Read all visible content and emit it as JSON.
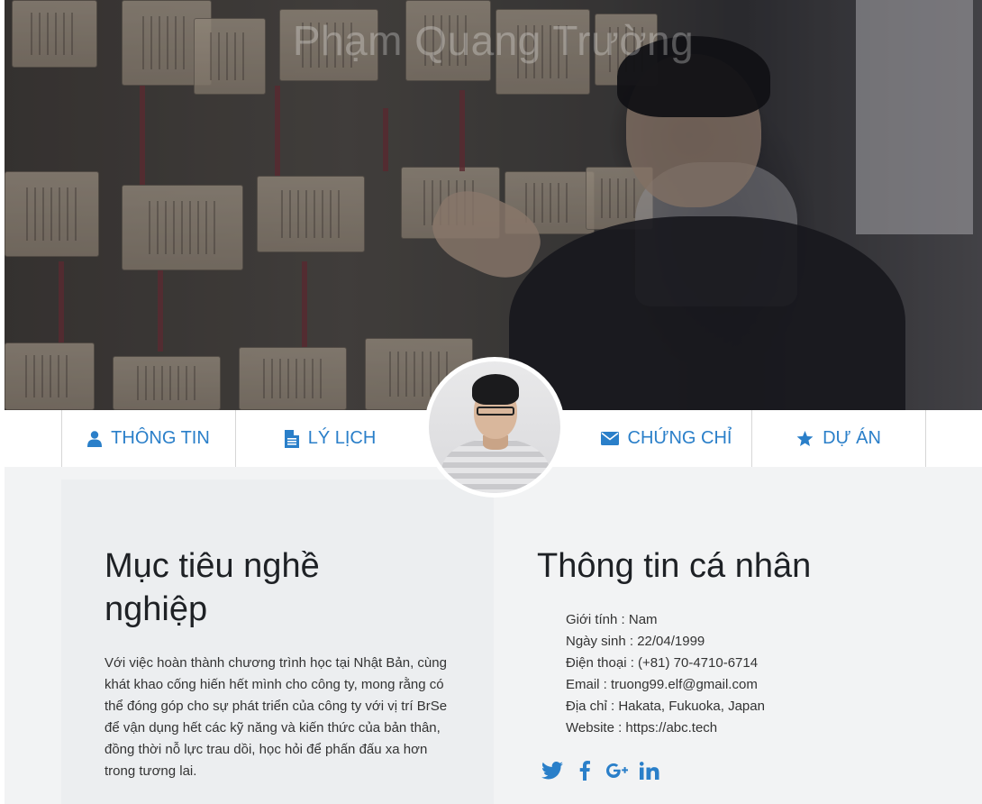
{
  "hero": {
    "title": "Phạm Quang Trường"
  },
  "nav": {
    "items": [
      {
        "label": "THÔNG TIN",
        "icon": "user-icon"
      },
      {
        "label": "LÝ LỊCH",
        "icon": "file-icon"
      },
      {
        "label": "CHỨNG CHỈ",
        "icon": "envelope-icon"
      },
      {
        "label": "DỰ ÁN",
        "icon": "star-icon"
      }
    ]
  },
  "career": {
    "heading": "Mục tiêu nghề nghiệp",
    "text": "Với việc hoàn thành chương trình học tại Nhật Bản, cùng khát khao cống hiến hết mình cho công ty, mong rằng có thể đóng góp cho sự phát triển của công ty với vị trí BrSe để vận dụng hết các kỹ năng và kiến thức của bản thân, đồng thời nỗ lực trau dồi, học hỏi để phấn đấu xa hơn trong tương lai."
  },
  "personal": {
    "heading": "Thông tin cá nhân",
    "gender": "Giới tính : Nam",
    "birth": "Ngày sinh : 22/04/1999",
    "phone": "Điện thoại : (+81) 70-4710-6714",
    "email": "Email : truong99.elf@gmail.com",
    "address": "Địa chỉ : Hakata, Fukuoka, Japan",
    "website": "Website : https://abc.tech"
  },
  "social": [
    "twitter-icon",
    "facebook-icon",
    "google-plus-icon",
    "linkedin-icon"
  ],
  "colors": {
    "accent": "#2a7fc9",
    "content_bg": "#f2f3f4",
    "left_panel_bg": "#eceef0"
  }
}
